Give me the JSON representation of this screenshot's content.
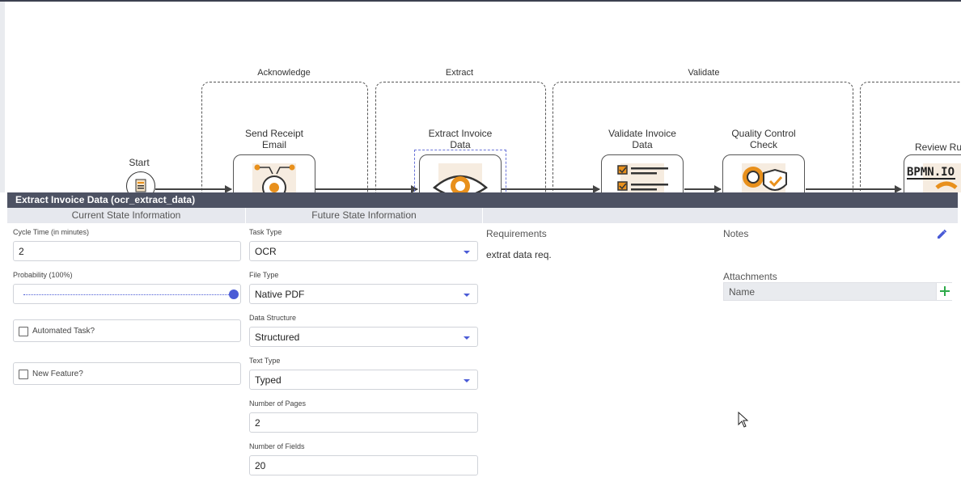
{
  "diagram": {
    "lanes": [
      {
        "label": "Acknowledge"
      },
      {
        "label": "Extract"
      },
      {
        "label": "Validate"
      }
    ],
    "start_label": "Start",
    "tasks": [
      {
        "label": "Send Receipt Email",
        "icon": "gear-network-icon"
      },
      {
        "label": "Extract Invoice Data",
        "icon": "eye-icon"
      },
      {
        "label": "Validate Invoice Data",
        "icon": "checklist-icon"
      },
      {
        "label": "Quality Control Check",
        "icon": "shield-gear-icon"
      },
      {
        "label": "Review Ru",
        "icon": "bpmn-logo-icon"
      }
    ],
    "bpmn_logo_text": "BPMN.IO"
  },
  "panel": {
    "title": "Extract Invoice Data (ocr_extract_data)",
    "current_header": "Current State Information",
    "future_header": "Future State Information",
    "cycle_time_label": "Cycle Time (in minutes)",
    "cycle_time_value": "2",
    "probability_label": "Probability (100%)",
    "probability_value": 1.0,
    "automated_label": "Automated Task?",
    "new_feature_label": "New Feature?",
    "task_type_label": "Task Type",
    "task_type_value": "OCR",
    "file_type_label": "File Type",
    "file_type_value": "Native PDF",
    "data_structure_label": "Data Structure",
    "data_structure_value": "Structured",
    "text_type_label": "Text Type",
    "text_type_value": "Typed",
    "pages_label": "Number of Pages",
    "pages_value": "2",
    "fields_label": "Number of Fields",
    "fields_value": "20",
    "requirements_label": "Requirements",
    "requirements_value": "extrat data req.",
    "notes_label": "Notes",
    "attachments_label": "Attachments",
    "attachments_col_name": "Name",
    "accent_color": "#4a5bd6",
    "add_color": "#2eaa4a"
  }
}
